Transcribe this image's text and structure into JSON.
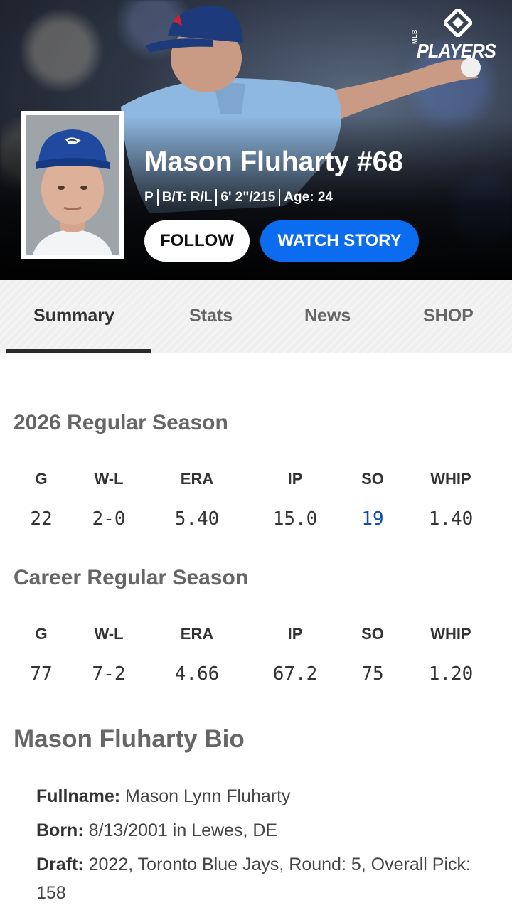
{
  "hero": {
    "brand": {
      "prefix": "MLB",
      "word": "PLAYERS"
    },
    "player_name": "Mason Fluharty #68",
    "meta": [
      "P",
      "B/T: R/L",
      "6' 2\"/215",
      "Age: 24"
    ],
    "follow_label": "FOLLOW",
    "watch_label": "WATCH STORY"
  },
  "tabs": [
    {
      "label": "Summary",
      "active": true
    },
    {
      "label": "Stats"
    },
    {
      "label": "News"
    },
    {
      "label": "SHOP"
    }
  ],
  "season": {
    "title": "2026 Regular Season",
    "headers": [
      "G",
      "W-L",
      "ERA",
      "IP",
      "SO",
      "WHIP"
    ],
    "values": [
      "22",
      "2-0",
      "5.40",
      "15.0",
      "19",
      "1.40"
    ]
  },
  "career": {
    "title": "Career Regular Season",
    "headers": [
      "G",
      "W-L",
      "ERA",
      "IP",
      "SO",
      "WHIP"
    ],
    "values": [
      "77",
      "7-2",
      "4.66",
      "67.2",
      "75",
      "1.20"
    ]
  },
  "bio": {
    "title": "Mason Fluharty Bio",
    "fullname_label": "Fullname:",
    "fullname": "Mason Lynn Fluharty",
    "born_label": "Born:",
    "born": "8/13/2001 in Lewes, DE",
    "draft_label": "Draft:",
    "draft": "2022, Toronto Blue Jays, Round: 5, Overall Pick: 158"
  },
  "colors": {
    "accent": "#0b6cf0",
    "link": "#0d4fa8",
    "jersey": "#8fb8e0",
    "cap": "#1d3a7a"
  }
}
